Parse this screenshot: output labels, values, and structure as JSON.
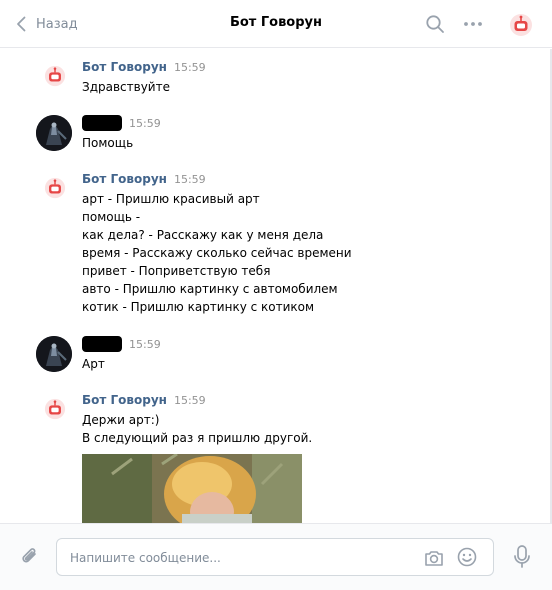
{
  "header": {
    "back_label": "Назад",
    "title": "Бот Говорун",
    "icons": [
      "chevron-left-icon",
      "search-icon",
      "more-icon",
      "bot-avatar-icon"
    ]
  },
  "colors": {
    "accent_link": "#42648b",
    "muted": "#818c99",
    "bot_icon": "#e64646",
    "divider": "#e7e8ec"
  },
  "messages": [
    {
      "author": "Бот Говорун",
      "time": "15:59",
      "lines": [
        "Здравствуйте"
      ]
    },
    {
      "author": "",
      "time": "15:59",
      "lines": [
        "Помощь"
      ]
    },
    {
      "author": "Бот Говорун",
      "time": "15:59",
      "lines": [
        "арт - Пришлю красивый арт",
        "помощь -",
        "как дела? - Расскажу как у меня дела",
        "время - Расскажу сколько сейчас времени",
        "привет - Поприветствую тебя",
        "авто - Пришлю картинку с автомобилем",
        "котик - Пришлю картинку с котиком"
      ]
    },
    {
      "author": "",
      "time": "15:59",
      "lines": [
        "Арт"
      ]
    },
    {
      "author": "Бот Говорун",
      "time": "15:59",
      "lines": [
        "Держи арт:)",
        "В следующий раз я пришлю другой."
      ]
    }
  ],
  "composer": {
    "placeholder": "Напишите сообщение..."
  }
}
